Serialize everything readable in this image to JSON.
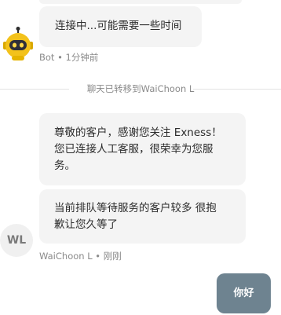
{
  "messages": {
    "bot": {
      "text": "连接中...可能需要一些时间",
      "meta": "Bot • 1分钟前"
    },
    "system_notice": "聊天已转移到WaiChoon L",
    "agent": {
      "avatar_initials": "WL",
      "message1_lines": [
        "尊敬的客户，感谢您关注 Exness！",
        "您已连接人工客服，很荣幸为您服",
        "务。"
      ],
      "message2_lines": [
        "当前排队等待服务的客户较多 很抱",
        "歉让您久等了"
      ],
      "meta": "WaiChoon L • 刚刚"
    },
    "user": {
      "text": "你好"
    }
  },
  "colors": {
    "bubble_bg": "#f4f4f4",
    "user_bubble_bg": "#6e8390",
    "meta_text": "#8a8a8a"
  }
}
